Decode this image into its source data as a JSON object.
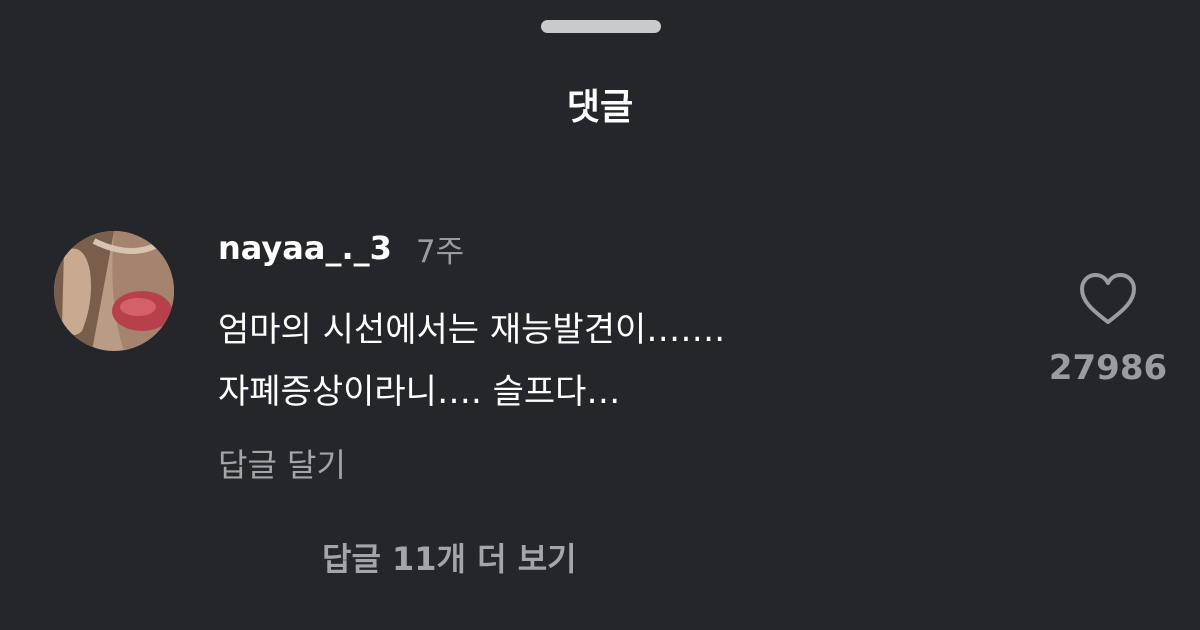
{
  "sheet": {
    "title": "댓글"
  },
  "comment": {
    "username": "nayaa_._3",
    "time_ago": "7주",
    "text_line1": "엄마의 시선에서는 재능발견이…….",
    "text_line2": "자폐증상이라니…. 슬프다…",
    "reply_label": "답글 달기",
    "like_count": "27986",
    "like_icon": "heart-outline-icon",
    "view_replies_label": "답글 11개 더 보기"
  },
  "colors": {
    "background": "#25262b",
    "primary_text": "#ffffff",
    "secondary_text": "#9b9ca1",
    "handle": "#c9cacd"
  }
}
